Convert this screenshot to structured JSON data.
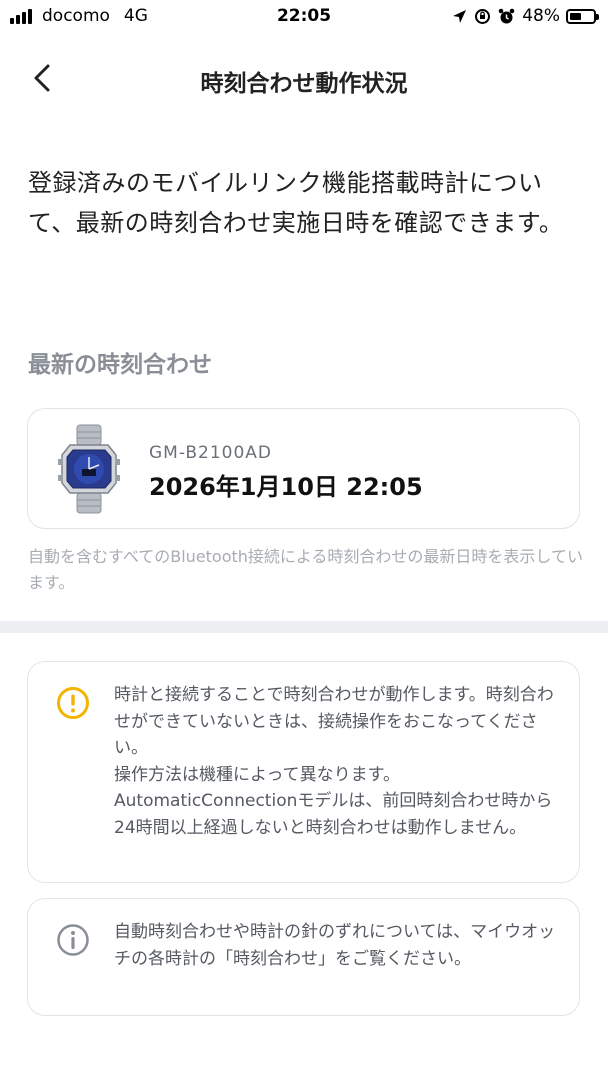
{
  "status_bar": {
    "carrier": "docomo",
    "network": "4G",
    "time": "22:05",
    "battery": "48%",
    "battery_level": 0.48
  },
  "nav": {
    "title": "時刻合わせ動作状況"
  },
  "intro": "登録済みのモバイルリンク機能搭載時計について、最新の時刻合わせ実施日時を確認できます。",
  "latest": {
    "section_title": "最新の時刻合わせ",
    "model": "GM-B2100AD",
    "datetime": "2026年1月10日 22:05",
    "note": "自動を含むすべてのBluetooth接続による時刻合わせの最新日時を表示しています。"
  },
  "warning_card": {
    "icon": "warning-circle-icon",
    "icon_color": "#f2b400",
    "paragraph1": "時計と接続することで時刻合わせが動作します。時刻合わせができていないときは、接続操作をおこなってください。",
    "paragraph2": "操作方法は機種によって異なります。AutomaticConnectionモデルは、前回時刻合わせ時から24時間以上経過しないと時刻合わせは動作しません。"
  },
  "info_card": {
    "icon": "info-circle-icon",
    "icon_color": "#8a8f97",
    "text": "自動時刻合わせや時計の針のずれについては、マイウオッチの各時計の「時刻合わせ」をご覧ください。"
  }
}
